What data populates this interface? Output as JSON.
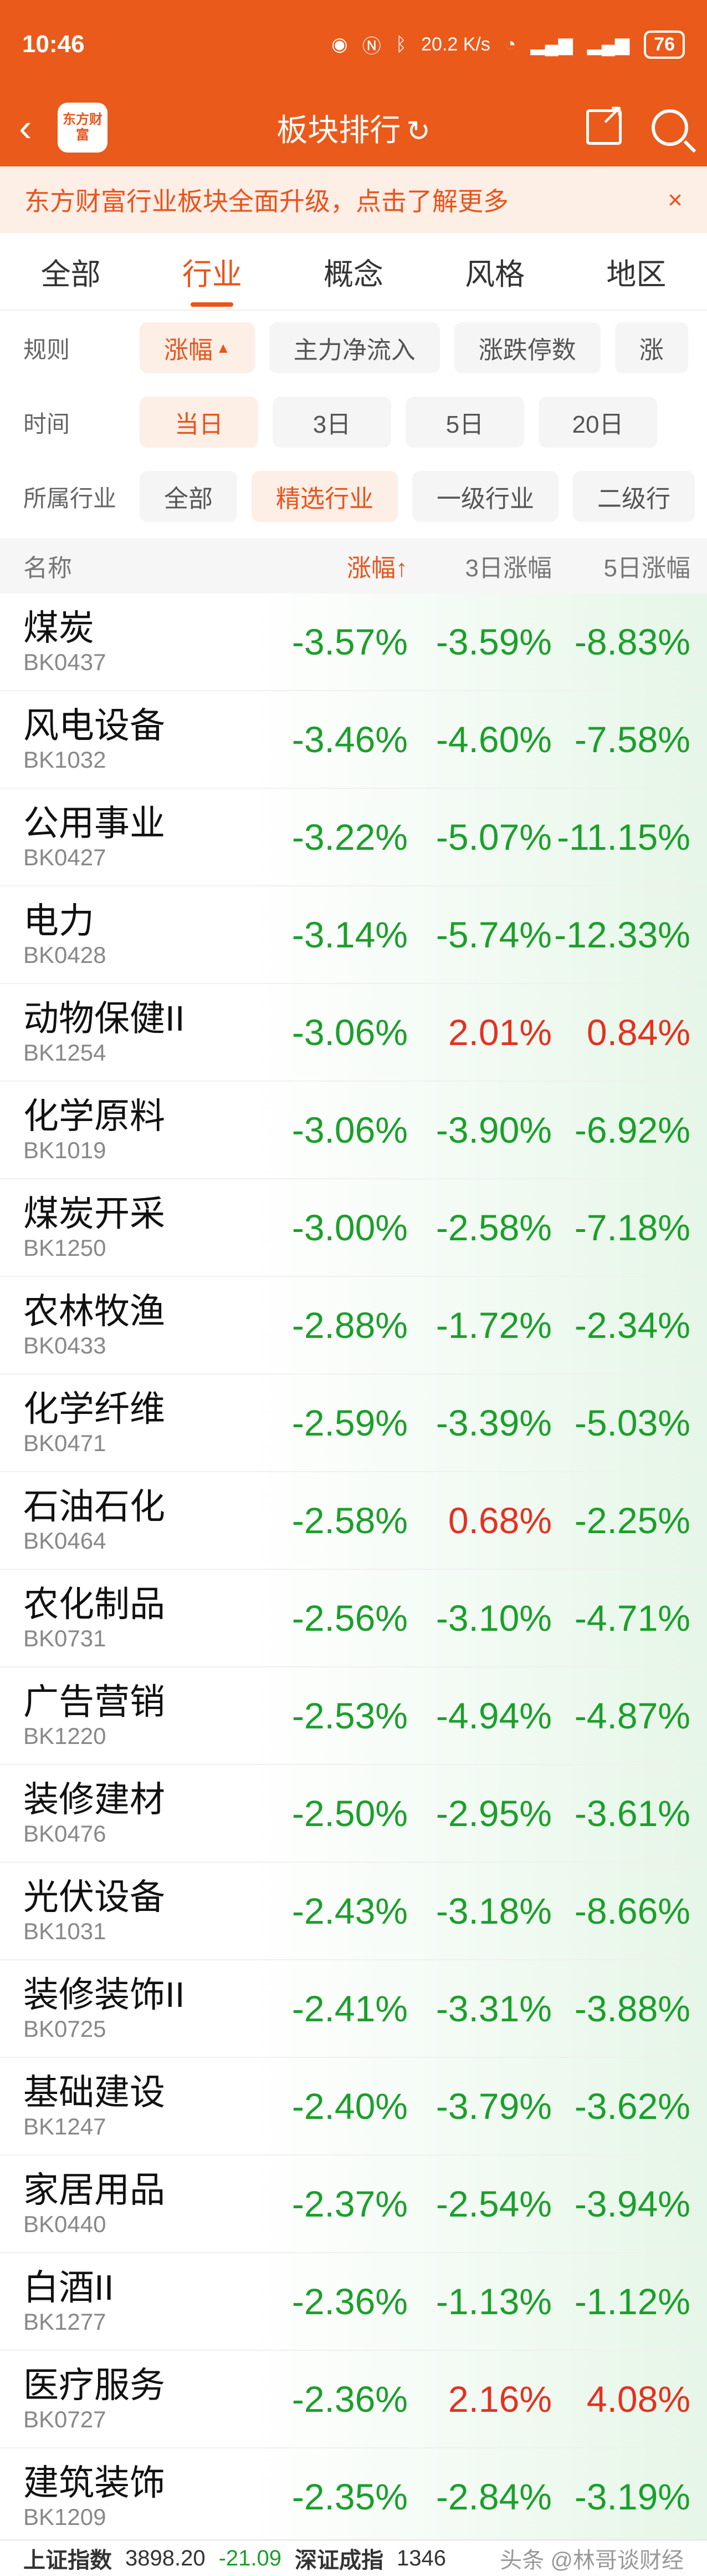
{
  "status": {
    "time": "10:46",
    "net_speed": "20.2 K/s",
    "battery": "76"
  },
  "header": {
    "back_icon": "back-arrow-icon",
    "logo_text": "东方财富",
    "title": "板块排行",
    "refresh_icon": "refresh-icon",
    "share_icon": "share-icon",
    "search_icon": "search-icon"
  },
  "notice": {
    "text": "东方财富行业板块全面升级，点击了解更多",
    "close": "×"
  },
  "tabs": [
    "全部",
    "行业",
    "概念",
    "风格",
    "地区"
  ],
  "filters": {
    "rule": {
      "label": "规则",
      "options": [
        "涨幅",
        "主力净流入",
        "涨跌停数",
        "涨"
      ]
    },
    "time": {
      "label": "时间",
      "options": [
        "当日",
        "3日",
        "5日",
        "20日"
      ]
    },
    "industry": {
      "label": "所属行业",
      "options": [
        "全部",
        "精选行业",
        "一级行业",
        "二级行"
      ]
    }
  },
  "table": {
    "headers": {
      "name": "名称",
      "c1": "涨幅↑",
      "c2": "3日涨幅",
      "c3": "5日涨幅"
    },
    "rows": [
      {
        "name": "煤炭",
        "code": "BK0437",
        "d1": "-3.57%",
        "d3": "-3.59%",
        "d5": "-8.83%"
      },
      {
        "name": "风电设备",
        "code": "BK1032",
        "d1": "-3.46%",
        "d3": "-4.60%",
        "d5": "-7.58%"
      },
      {
        "name": "公用事业",
        "code": "BK0427",
        "d1": "-3.22%",
        "d3": "-5.07%",
        "d5": "-11.15%"
      },
      {
        "name": "电力",
        "code": "BK0428",
        "d1": "-3.14%",
        "d3": "-5.74%",
        "d5": "-12.33%"
      },
      {
        "name": "动物保健II",
        "code": "BK1254",
        "d1": "-3.06%",
        "d3": "2.01%",
        "d5": "0.84%"
      },
      {
        "name": "化学原料",
        "code": "BK1019",
        "d1": "-3.06%",
        "d3": "-3.90%",
        "d5": "-6.92%"
      },
      {
        "name": "煤炭开采",
        "code": "BK1250",
        "d1": "-3.00%",
        "d3": "-2.58%",
        "d5": "-7.18%"
      },
      {
        "name": "农林牧渔",
        "code": "BK0433",
        "d1": "-2.88%",
        "d3": "-1.72%",
        "d5": "-2.34%"
      },
      {
        "name": "化学纤维",
        "code": "BK0471",
        "d1": "-2.59%",
        "d3": "-3.39%",
        "d5": "-5.03%"
      },
      {
        "name": "石油石化",
        "code": "BK0464",
        "d1": "-2.58%",
        "d3": "0.68%",
        "d5": "-2.25%"
      },
      {
        "name": "农化制品",
        "code": "BK0731",
        "d1": "-2.56%",
        "d3": "-3.10%",
        "d5": "-4.71%"
      },
      {
        "name": "广告营销",
        "code": "BK1220",
        "d1": "-2.53%",
        "d3": "-4.94%",
        "d5": "-4.87%"
      },
      {
        "name": "装修建材",
        "code": "BK0476",
        "d1": "-2.50%",
        "d3": "-2.95%",
        "d5": "-3.61%"
      },
      {
        "name": "光伏设备",
        "code": "BK1031",
        "d1": "-2.43%",
        "d3": "-3.18%",
        "d5": "-8.66%"
      },
      {
        "name": "装修装饰II",
        "code": "BK0725",
        "d1": "-2.41%",
        "d3": "-3.31%",
        "d5": "-3.88%"
      },
      {
        "name": "基础建设",
        "code": "BK1247",
        "d1": "-2.40%",
        "d3": "-3.79%",
        "d5": "-3.62%"
      },
      {
        "name": "家居用品",
        "code": "BK0440",
        "d1": "-2.37%",
        "d3": "-2.54%",
        "d5": "-3.94%"
      },
      {
        "name": "白酒II",
        "code": "BK1277",
        "d1": "-2.36%",
        "d3": "-1.13%",
        "d5": "-1.12%"
      },
      {
        "name": "医疗服务",
        "code": "BK0727",
        "d1": "-2.36%",
        "d3": "2.16%",
        "d5": "4.08%"
      },
      {
        "name": "建筑装饰",
        "code": "BK1209",
        "d1": "-2.35%",
        "d3": "-2.84%",
        "d5": "-3.19%"
      }
    ]
  },
  "bottom": {
    "index1_name": "上证指数",
    "index1_value": "3898.20",
    "index1_change": "-21.09",
    "index2_name": "深证成指",
    "index2_value": "1346",
    "watermark": "头条 @林哥谈财经"
  },
  "colors": {
    "brand": "#ea5a1b",
    "down": "#1b9f2b",
    "up": "#e53121"
  }
}
